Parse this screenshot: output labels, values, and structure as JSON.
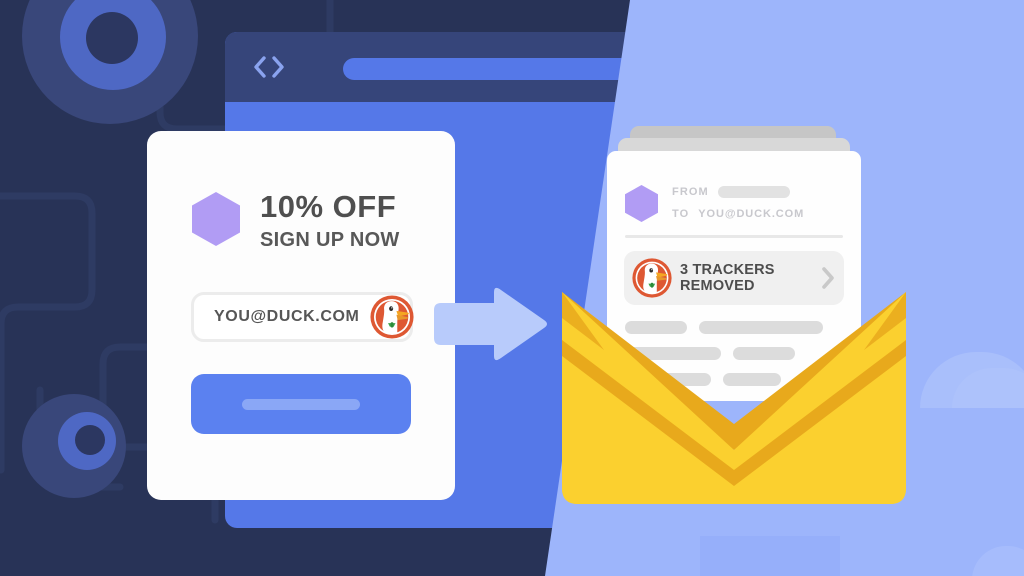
{
  "palette": {
    "bg_dark": "#283357",
    "bg_light_overlay": "#9db5fb",
    "browser_body": "#5578e8",
    "browser_chrome": "#36457a",
    "accent_blue": "#5b81f0",
    "card_white": "#fdfdfd",
    "hexagon_purple": "#b19cf4",
    "envelope_yellow": "#fbd02f",
    "envelope_shadow": "#e8a91c",
    "ddg_orange": "#de5833",
    "text_dark_grey": "#4f4f4f",
    "text_muted_grey": "#c8c8cd",
    "placeholder_grey": "#dcdcdc"
  },
  "browser": {
    "back_icon": "chevron-left-icon",
    "forward_icon": "chevron-right-icon",
    "address_bar_value": "",
    "address_bar_placeholder": "",
    "menu_icon": "hamburger-menu-icon"
  },
  "signup_card": {
    "brand_icon": "hexagon-logo-icon",
    "offer_title": "10% OFF",
    "offer_subtitle": "SIGN UP NOW",
    "email_input": {
      "value": "YOU@DUCK.COM",
      "placeholder": "YOU@DUCK.COM",
      "autofill_icon": "duckduckgo-logo-icon"
    },
    "submit_label": ""
  },
  "transfer": {
    "arrow_icon": "arrow-right-icon"
  },
  "email_card": {
    "brand_icon": "hexagon-logo-icon",
    "meta": [
      {
        "label": "FROM",
        "value": "",
        "redacted": true
      },
      {
        "label": "TO",
        "value": "YOU@DUCK.COM",
        "redacted": false
      }
    ],
    "tracker_banner": {
      "logo_icon": "duckduckgo-logo-icon",
      "line1": "3 TRACKERS",
      "line2": "REMOVED",
      "tracker_count": 3,
      "chevron_icon": "chevron-right-icon"
    },
    "body_placeholder_rows": [
      [
        62,
        124
      ],
      [
        96,
        62
      ],
      [
        86,
        58
      ]
    ]
  },
  "envelope": {
    "state": "open",
    "icon": "envelope-open-icon"
  },
  "decorations": {
    "circuit_nodes": 2,
    "clouds": 2
  }
}
